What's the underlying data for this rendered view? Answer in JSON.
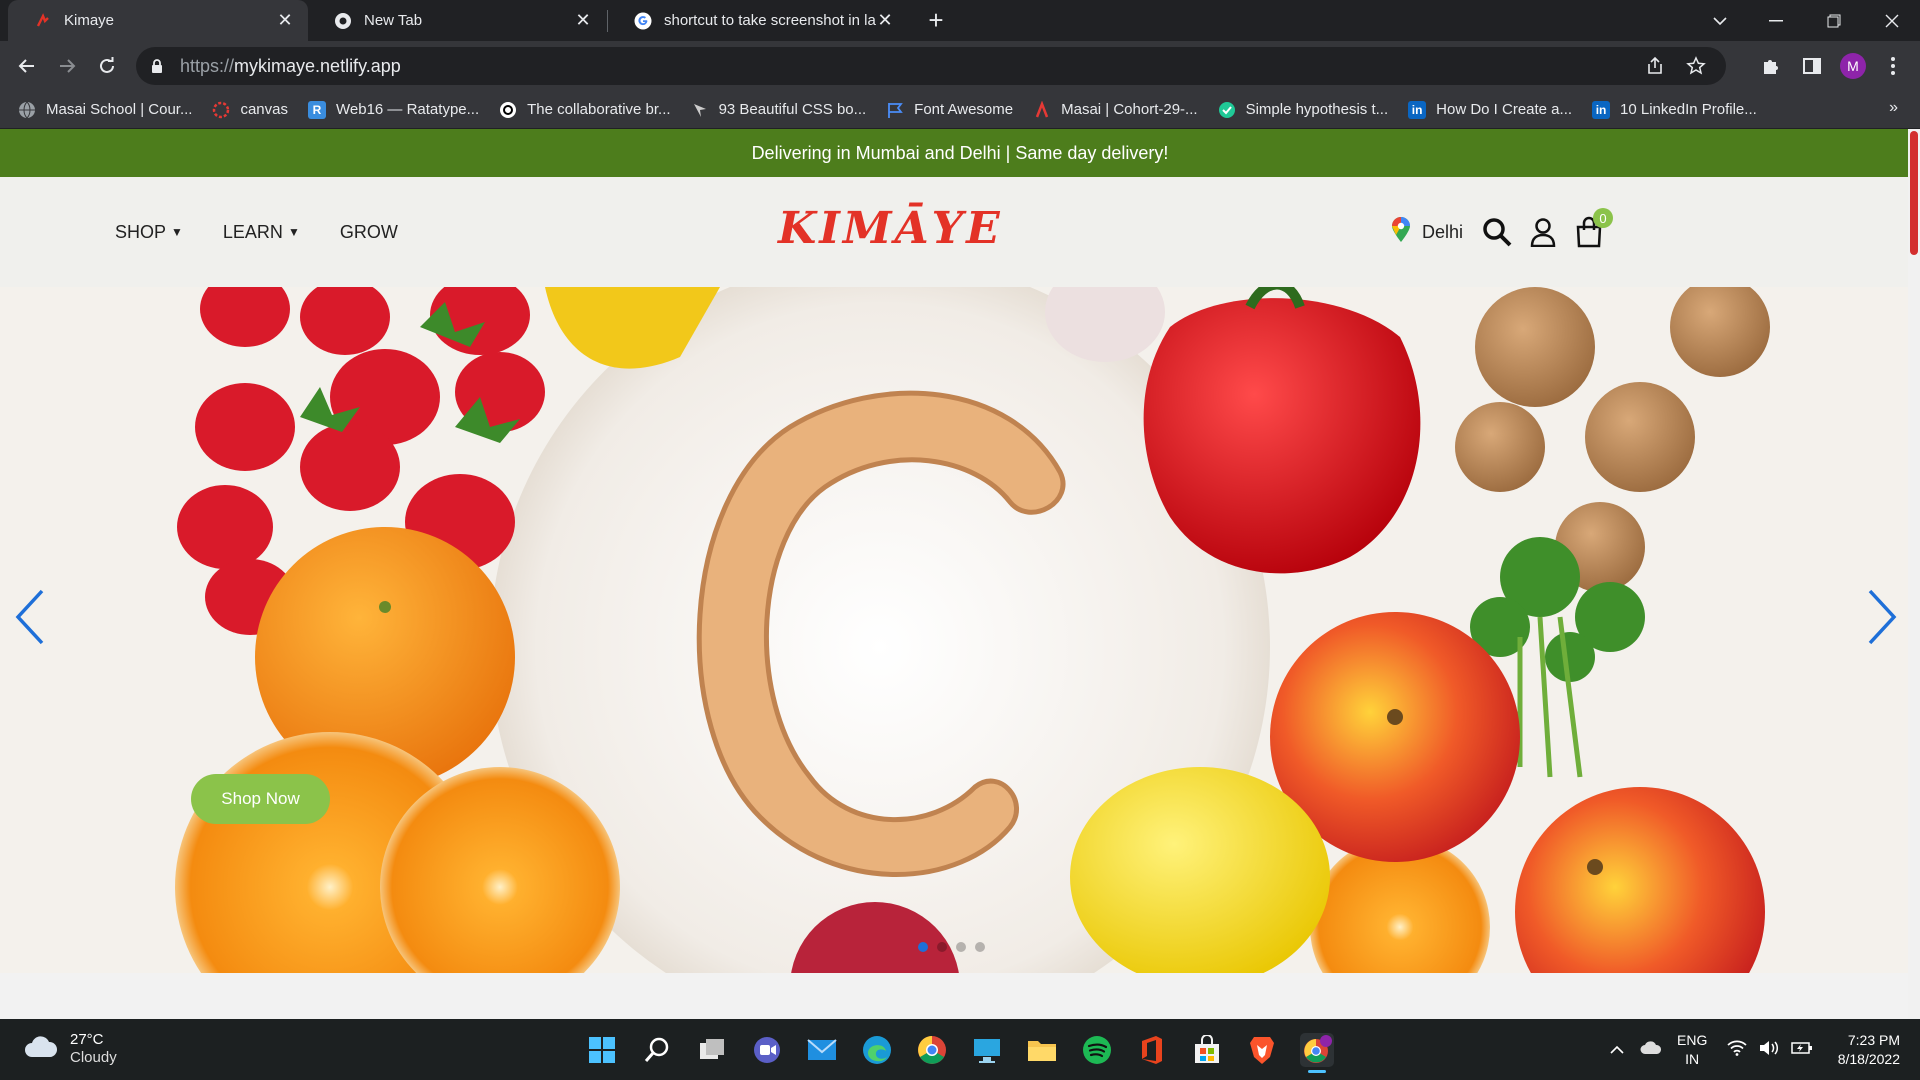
{
  "browser": {
    "tabs": [
      {
        "title": "Kimaye",
        "active": true
      },
      {
        "title": "New Tab",
        "active": false
      },
      {
        "title": "shortcut to take screenshot in lap",
        "active": false
      }
    ],
    "url_scheme": "https://",
    "url_host": "mykimaye.netlify.app",
    "profile_initial": "M",
    "bookmarks": [
      {
        "label": "Masai School | Cour...",
        "icon": "globe-icon"
      },
      {
        "label": "canvas",
        "icon": "canvas-icon"
      },
      {
        "label": "Web16 — Ratatype...",
        "icon": "ratatype-icon"
      },
      {
        "label": "The collaborative br...",
        "icon": "codesandbox-icon"
      },
      {
        "label": "93 Beautiful CSS bo...",
        "icon": "css-icon"
      },
      {
        "label": "Font Awesome",
        "icon": "flag-icon"
      },
      {
        "label": "Masai | Cohort-29-...",
        "icon": "masai-icon"
      },
      {
        "label": "Simple hypothesis t...",
        "icon": "shield-check-icon"
      },
      {
        "label": "How Do I Create a...",
        "icon": "linkedin-icon"
      },
      {
        "label": "10 LinkedIn Profile...",
        "icon": "linkedin-icon"
      }
    ],
    "bookmarks_more": "»"
  },
  "site": {
    "promo_text": "Delivering in Mumbai and Delhi | Same day delivery!",
    "nav": [
      {
        "label": "SHOP",
        "dropdown": true
      },
      {
        "label": "LEARN",
        "dropdown": true
      },
      {
        "label": "GROW",
        "dropdown": false
      }
    ],
    "logo_text": "KIMĀYE",
    "location": "Delhi",
    "cart_count": "0",
    "hero": {
      "button_label": "Shop Now",
      "slide_count": 4,
      "active_slide": 1,
      "letter": "C"
    },
    "colors": {
      "promo_bg": "#4d7d1c",
      "accent_green": "#8bc34a",
      "logo_red": "#e33227",
      "arrow_blue": "#1e6fd8"
    }
  },
  "taskbar": {
    "weather_temp": "27°C",
    "weather_cond": "Cloudy",
    "apps": [
      "start-icon",
      "search-icon",
      "task-view-icon",
      "teams-icon",
      "mail-icon",
      "edge-icon",
      "chrome-icon",
      "remote-desktop-icon",
      "file-explorer-icon",
      "spotify-icon",
      "office-icon",
      "store-icon",
      "brave-icon",
      "chrome-profile-icon"
    ],
    "lang_top": "ENG",
    "lang_bottom": "IN",
    "time": "7:23 PM",
    "date": "8/18/2022"
  }
}
